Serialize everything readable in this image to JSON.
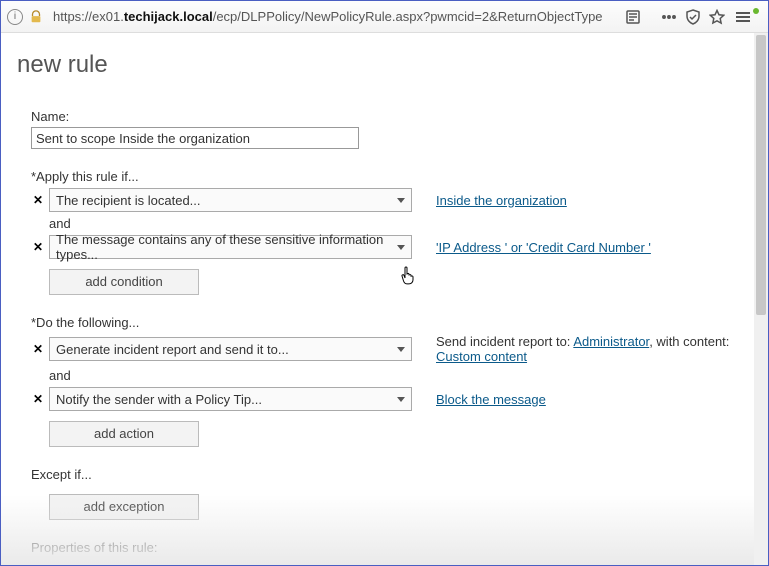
{
  "browser": {
    "url_prefix": "https://ex01.",
    "url_bold": "techijack.local",
    "url_suffix": "/ecp/DLPPolicy/NewPolicyRule.aspx?pwmcid=2&ReturnObjectType"
  },
  "heading": "new rule",
  "name": {
    "label": "Name:",
    "value": "Sent to scope Inside the organization"
  },
  "apply_if": {
    "label": "*Apply this rule if...",
    "conditions": [
      {
        "text": "The recipient is located...",
        "side_link": "Inside the organization"
      },
      {
        "text": "The message contains any of these sensitive information types...",
        "side_link": "'IP Address ' or 'Credit Card Number '"
      }
    ],
    "connector": "and",
    "add_button": "add condition"
  },
  "do_following": {
    "label": "*Do the following...",
    "actions": [
      {
        "text": "Generate incident report and send it to...",
        "side_prefix": "Send incident report to: ",
        "side_link1": "Administrator",
        "side_mid": ", with content: ",
        "side_link2": "Custom content"
      },
      {
        "text": "Notify the sender with a Policy Tip...",
        "side_link": "Block the message"
      }
    ],
    "connector": "and",
    "add_button": "add action"
  },
  "except_if": {
    "label": "Except if...",
    "add_button": "add exception"
  },
  "properties_label": "Properties of this rule:"
}
